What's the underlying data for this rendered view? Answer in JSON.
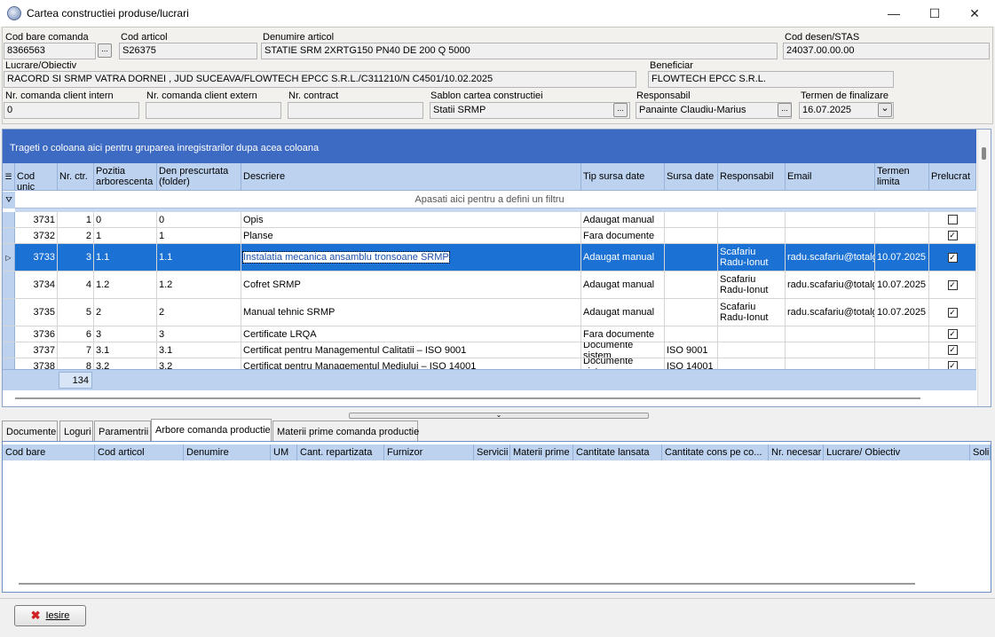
{
  "window": {
    "title": "Cartea constructiei produse/lucrari",
    "min": "—",
    "max": "☐",
    "close": "✕"
  },
  "header": {
    "cod_bare_label": "Cod bare comanda",
    "cod_bare": "8366563",
    "cod_articol_label": "Cod articol",
    "cod_articol": "S26375",
    "denumire_label": "Denumire articol",
    "denumire": "STATIE SRM 2XRTG150 PN40 DE 200 Q 5000",
    "cod_desen_label": "Cod desen/STAS",
    "cod_desen": "24037.00.00.00",
    "lucrare_label": "Lucrare/Obiectiv",
    "lucrare": "RACORD SI SRMP VATRA DORNEI , JUD SUCEAVA/FLOWTECH EPCC S.R.L./C311210/N C4501/10.02.2025",
    "beneficiar_label": "Beneficiar",
    "beneficiar": "FLOWTECH EPCC S.R.L.",
    "nr_cmd_intern_label": "Nr. comanda client intern",
    "nr_cmd_intern": "0",
    "nr_cmd_extern_label": "Nr. comanda client extern",
    "nr_cmd_extern": "",
    "nr_contract_label": "Nr. contract",
    "nr_contract": "",
    "sablon_label": "Sablon cartea constructiei",
    "sablon": "Statii SRMP",
    "responsabil_label": "Responsabil",
    "responsabil": "Panainte Claudiu-Marius",
    "termen_label": "Termen de finalizare",
    "termen": "16.07.2025",
    "dots": "...",
    "dropdown": "⌄"
  },
  "grid": {
    "group_hint": "Trageti o coloana aici pentru gruparea inregistrarilor dupa acea coloana",
    "filter_hint": "Apasati aici pentru a defini un filtru",
    "columns": [
      "Cod unic",
      "Nr. ctr.",
      "Pozitia arborescenta",
      "Den prescurtata (folder)",
      "Descriere",
      "Tip sursa date",
      "Sursa date",
      "Responsabil",
      "Email",
      "Termen limita",
      "Prelucrat"
    ],
    "rows": [
      {
        "cod": "3731",
        "nr": "1",
        "poz": "0",
        "den": "0",
        "descr": "Opis",
        "tip": "Adaugat manual",
        "sursa": "",
        "resp": "",
        "email": "",
        "termen": "",
        "prel": false
      },
      {
        "cod": "3732",
        "nr": "2",
        "poz": "1",
        "den": "1",
        "descr": "Planse",
        "tip": "Fara documente",
        "sursa": "",
        "resp": "",
        "email": "",
        "termen": "",
        "prel": true
      },
      {
        "cod": "3733",
        "nr": "3",
        "poz": "1.1",
        "den": "1.1",
        "descr": "Instalatia mecanica ansamblu tronsoane SRMP",
        "tip": "Adaugat manual",
        "sursa": "",
        "resp": "Scafariu Radu-Ionut",
        "email": "radu.scafariu@totalgaz.ro",
        "termen": "10.07.2025",
        "prel": true
      },
      {
        "cod": "3734",
        "nr": "4",
        "poz": "1.2",
        "den": "1.2",
        "descr": "Cofret SRMP",
        "tip": "Adaugat manual",
        "sursa": "",
        "resp": "Scafariu Radu-Ionut",
        "email": "radu.scafariu@totalgaz.ro",
        "termen": "10.07.2025",
        "prel": true
      },
      {
        "cod": "3735",
        "nr": "5",
        "poz": "2",
        "den": "2",
        "descr": "Manual tehnic SRMP",
        "tip": "Adaugat manual",
        "sursa": "",
        "resp": "Scafariu Radu-Ionut",
        "email": "radu.scafariu@totalgaz.ro",
        "termen": "10.07.2025",
        "prel": true
      },
      {
        "cod": "3736",
        "nr": "6",
        "poz": "3",
        "den": "3",
        "descr": "Certificate LRQA",
        "tip": "Fara documente",
        "sursa": "",
        "resp": "",
        "email": "",
        "termen": "",
        "prel": true
      },
      {
        "cod": "3737",
        "nr": "7",
        "poz": "3.1",
        "den": "3.1",
        "descr": "Certificat pentru Managementul Calitatii – ISO 9001",
        "tip": "Documente sistem",
        "sursa": "ISO 9001",
        "resp": "",
        "email": "",
        "termen": "",
        "prel": true
      },
      {
        "cod": "3738",
        "nr": "8",
        "poz": "3.2",
        "den": "3.2",
        "descr": "Certificat pentru Managementul Mediului – ISO 14001",
        "tip": "Documente sistem",
        "sursa": "ISO 14001",
        "resp": "",
        "email": "",
        "termen": "",
        "prel": true
      }
    ],
    "count": "134",
    "check_mark": "✓",
    "row_pointer": "▷"
  },
  "tabs": [
    "Documente",
    "Loguri",
    "Paramentrii",
    "Arbore comanda productie",
    "Materii prime comanda productie"
  ],
  "bottom_columns": [
    "Cod bare",
    "Cod articol",
    "Denumire",
    "UM",
    "Cant. repartizata",
    "Furnizor",
    "Servicii",
    "Materii prime",
    "Cantitate lansata",
    "Cantitate cons pe co...",
    "Nr. necesar",
    "Lucrare/ Obiectiv",
    "Soli"
  ],
  "buttons": {
    "exit": "Iesire",
    "exit_icon": "✖"
  }
}
